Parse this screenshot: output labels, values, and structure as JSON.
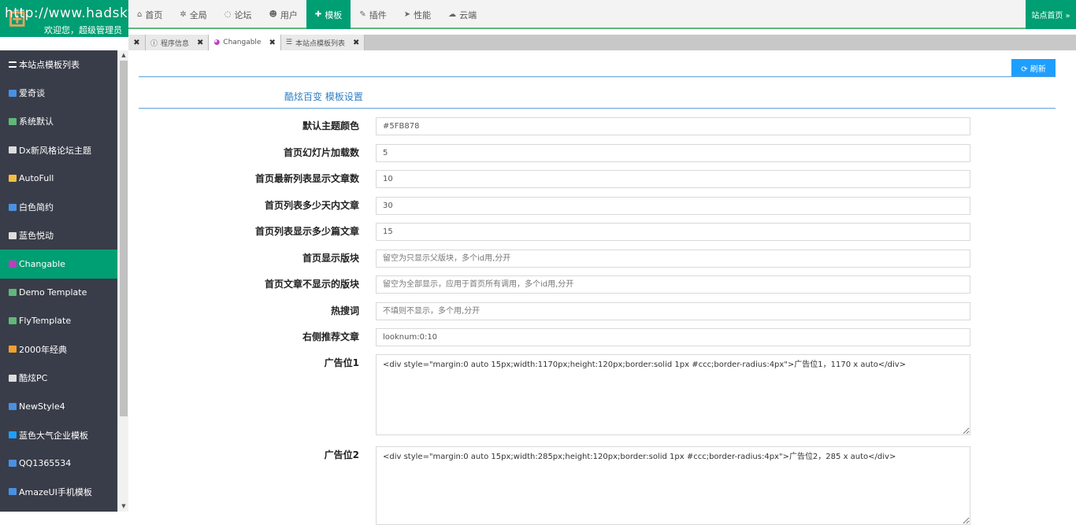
{
  "header": {
    "logo_url": "http://www.hadsky.com",
    "welcome": "欢迎您，超级管理员",
    "nav": [
      {
        "label": "首页",
        "icon": "home-icon",
        "glyph": "⌂"
      },
      {
        "label": "全局",
        "icon": "gears-icon",
        "glyph": "✲"
      },
      {
        "label": "论坛",
        "icon": "comment-icon",
        "glyph": "◌"
      },
      {
        "label": "用户",
        "icon": "users-icon",
        "glyph": "☻"
      },
      {
        "label": "模板",
        "icon": "puzzle-icon",
        "glyph": "✚"
      },
      {
        "label": "插件",
        "icon": "plug-icon",
        "glyph": "✎"
      },
      {
        "label": "性能",
        "icon": "send-icon",
        "glyph": "➤"
      },
      {
        "label": "云端",
        "icon": "cloud-icon",
        "glyph": "☁"
      }
    ],
    "active_nav": "模板",
    "site_home": "站点首页 »"
  },
  "tabs": {
    "close_all": "✖",
    "items": [
      {
        "label": "程序信息",
        "icon": "info-icon",
        "glyph": "ⓘ",
        "close": "✖"
      },
      {
        "label": "Changable",
        "icon": "palette-icon",
        "glyph": "◕",
        "close": "✖"
      },
      {
        "label": "本站点模板列表",
        "icon": "list-icon",
        "glyph": "☰",
        "close": "✖"
      }
    ]
  },
  "sidebar": {
    "items": [
      {
        "label": "本站点模板列表",
        "icon": "list-icon",
        "color": "#ffffff"
      },
      {
        "label": "爱奇谈",
        "icon": "template-icon",
        "color": "#4a90e2"
      },
      {
        "label": "系统默认",
        "icon": "template-icon",
        "color": "#5fb878"
      },
      {
        "label": "Dx新风格论坛主题",
        "icon": "template-icon",
        "color": "#dddddd"
      },
      {
        "label": "AutoFull",
        "icon": "template-icon",
        "color": "#f0c040"
      },
      {
        "label": "白色简约",
        "icon": "template-icon",
        "color": "#4a90e2"
      },
      {
        "label": "蓝色悦动",
        "icon": "template-icon",
        "color": "#dddddd"
      },
      {
        "label": "Changable",
        "icon": "template-icon",
        "color": "#c03cc0"
      },
      {
        "label": "Demo Template",
        "icon": "template-icon",
        "color": "#5fb878"
      },
      {
        "label": "FlyTemplate",
        "icon": "template-icon",
        "color": "#5fb878"
      },
      {
        "label": "2000年经典",
        "icon": "template-icon",
        "color": "#f0a030"
      },
      {
        "label": "酷炫PC",
        "icon": "template-icon",
        "color": "#dddddd"
      },
      {
        "label": "NewStyle4",
        "icon": "template-icon",
        "color": "#4a90e2"
      },
      {
        "label": "蓝色大气企业模板",
        "icon": "template-icon",
        "color": "#1e9fff"
      },
      {
        "label": "QQ1365534",
        "icon": "template-icon",
        "color": "#4a90e2"
      },
      {
        "label": "AmazeUI手机模板",
        "icon": "template-icon",
        "color": "#4a90e2"
      }
    ],
    "active": "Changable"
  },
  "main": {
    "refresh_label": "⟳ 刷新",
    "section_title": "酷炫百变 模板设置",
    "fields": [
      {
        "label": "默认主题颜色",
        "value": "#5FB878",
        "placeholder": ""
      },
      {
        "label": "首页幻灯片加载数",
        "value": "5",
        "placeholder": ""
      },
      {
        "label": "首页最新列表显示文章数",
        "value": "10",
        "placeholder": ""
      },
      {
        "label": "首页列表多少天内文章",
        "value": "30",
        "placeholder": ""
      },
      {
        "label": "首页列表显示多少篇文章",
        "value": "15",
        "placeholder": ""
      },
      {
        "label": "首页显示版块",
        "value": "",
        "placeholder": "留空为只显示父版块，多个id用,分开"
      },
      {
        "label": "首页文章不显示的版块",
        "value": "",
        "placeholder": "留空为全部显示，应用于首页所有调用，多个id用,分开"
      },
      {
        "label": "热搜词",
        "value": "",
        "placeholder": "不填则不显示，多个用,分开"
      },
      {
        "label": "右侧推荐文章",
        "value": "looknum:0:10",
        "placeholder": ""
      }
    ],
    "ads": [
      {
        "label": "广告位1",
        "value": "<div style=\"margin:0 auto 15px;width:1170px;height:120px;border:solid 1px #ccc;border-radius:4px\">广告位1，1170 x auto</div>"
      },
      {
        "label": "广告位2",
        "value": "<div style=\"margin:0 auto 15px;width:285px;height:120px;border:solid 1px #ccc;border-radius:4px\">广告位2，285 x auto</div>"
      }
    ]
  },
  "colors": {
    "brand_green": "#009e73",
    "theme_green": "#5fb878",
    "sidebar_bg": "#393d49",
    "refresh_blue": "#1e9fff"
  }
}
